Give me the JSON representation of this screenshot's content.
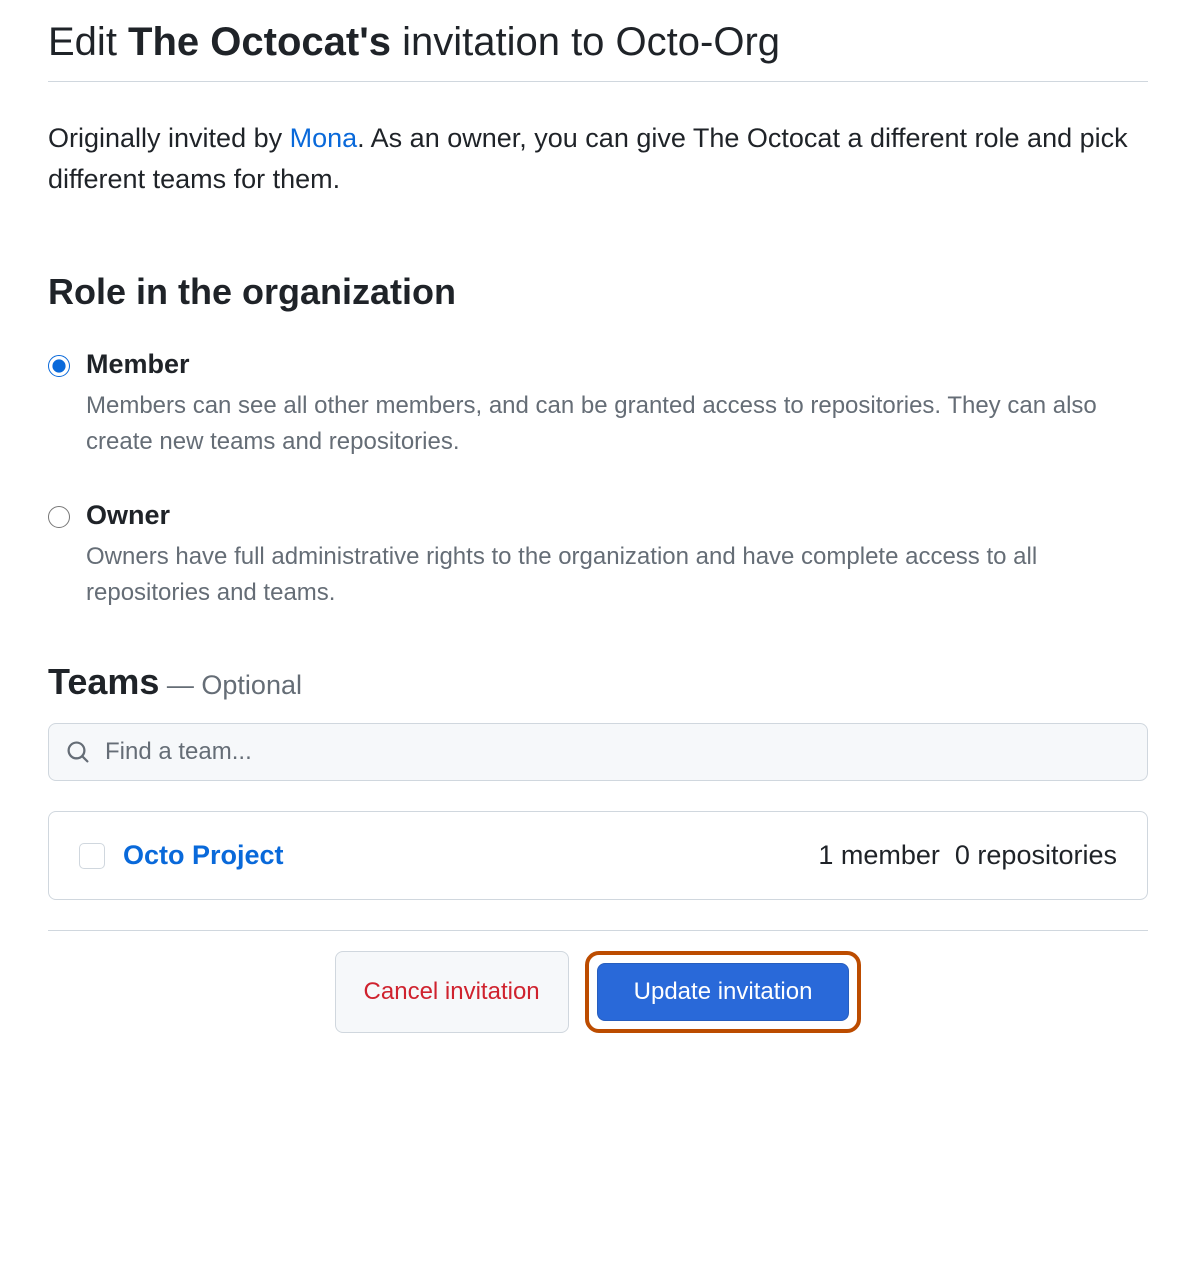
{
  "title": {
    "prefix": "Edit ",
    "name": "The Octocat's",
    "suffix": " invitation to Octo-Org"
  },
  "description": {
    "prefix": "Originally invited by ",
    "inviter": "Mona",
    "suffix": ". As an owner, you can give The Octocat a different role and pick different teams for them."
  },
  "roleSection": {
    "heading": "Role in the organization"
  },
  "roles": [
    {
      "label": "Member",
      "description": "Members can see all other members, and can be granted access to repositories. They can also create new teams and repositories.",
      "selected": true
    },
    {
      "label": "Owner",
      "description": "Owners have full administrative rights to the organization and have complete access to all repositories and teams.",
      "selected": false
    }
  ],
  "teamsSection": {
    "heading": "Teams",
    "optional": " — Optional"
  },
  "search": {
    "placeholder": "Find a team..."
  },
  "teams": [
    {
      "name": "Octo Project",
      "members": "1 member",
      "repos": "0 repositories",
      "checked": false
    }
  ],
  "buttons": {
    "cancel": "Cancel invitation",
    "update": "Update invitation"
  }
}
